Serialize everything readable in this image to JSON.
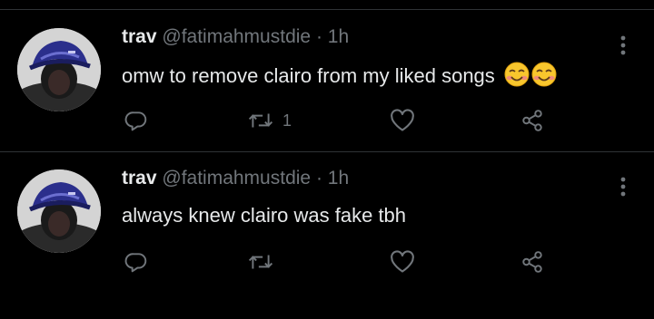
{
  "tweets": [
    {
      "name": "trav",
      "handle": "@fatimahmustdie",
      "separator": "·",
      "time": "1h",
      "text": "omw to remove clairo from my liked songs",
      "emoji_names": [
        "smiling-face-with-smiling-eyes-icon",
        "smiling-face-with-smiling-eyes-icon"
      ],
      "retweet_count": "1"
    },
    {
      "name": "trav",
      "handle": "@fatimahmustdie",
      "separator": "·",
      "time": "1h",
      "text": "always knew clairo was fake tbh",
      "emoji_names": [],
      "retweet_count": ""
    }
  ],
  "colors": {
    "background": "#000000",
    "primary_text": "#e7e9ea",
    "secondary_text": "#71767b",
    "divider": "#2f3336"
  },
  "icons": [
    "reply-icon",
    "retweet-icon",
    "like-icon",
    "share-icon",
    "more-options-icon"
  ]
}
